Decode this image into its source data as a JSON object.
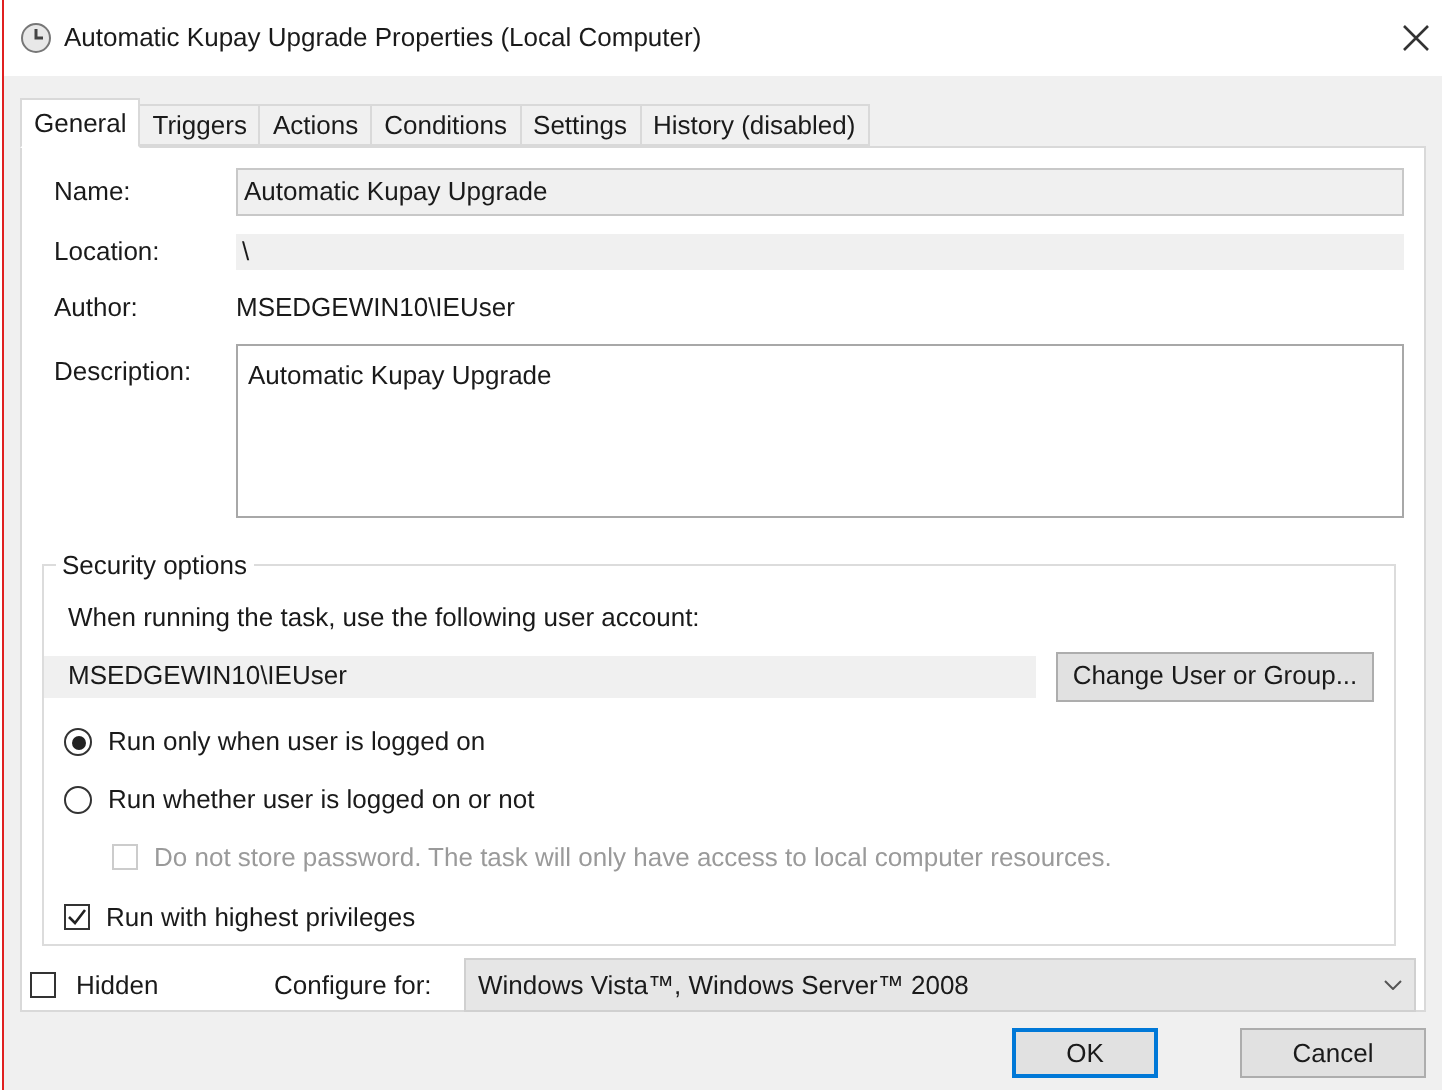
{
  "window": {
    "title": "Automatic Kupay Upgrade Properties (Local Computer)"
  },
  "tabs": [
    {
      "label": "General",
      "selected": true
    },
    {
      "label": "Triggers",
      "selected": false
    },
    {
      "label": "Actions",
      "selected": false
    },
    {
      "label": "Conditions",
      "selected": false
    },
    {
      "label": "Settings",
      "selected": false
    },
    {
      "label": "History (disabled)",
      "selected": false
    }
  ],
  "general": {
    "name_label": "Name:",
    "name": "Automatic Kupay Upgrade",
    "location_label": "Location:",
    "location": "\\",
    "author_label": "Author:",
    "author": "MSEDGEWIN10\\IEUser",
    "description_label": "Description:",
    "description": "Automatic Kupay Upgrade"
  },
  "security": {
    "title": "Security options",
    "account_prompt": "When running the task, use the following user account:",
    "account": "MSEDGEWIN10\\IEUser",
    "change_button": "Change User or Group...",
    "options": [
      {
        "kind": "radio",
        "label": "Run only when user is logged on",
        "selected": true,
        "disabled": false
      },
      {
        "kind": "radio",
        "label": "Run whether user is logged on or not",
        "selected": false,
        "disabled": false
      },
      {
        "kind": "checkbox",
        "label": "Do not store password.  The task will only have access to local computer resources.",
        "checked": false,
        "disabled": true
      },
      {
        "kind": "checkbox",
        "label": "Run with highest privileges",
        "checked": true,
        "disabled": false
      }
    ]
  },
  "hidden": {
    "label": "Hidden",
    "checked": false
  },
  "configure": {
    "label": "Configure for:",
    "value": "Windows Vista™, Windows Server™ 2008"
  },
  "buttons": [
    {
      "label": "OK",
      "default": true
    },
    {
      "label": "Cancel",
      "default": false
    }
  ]
}
